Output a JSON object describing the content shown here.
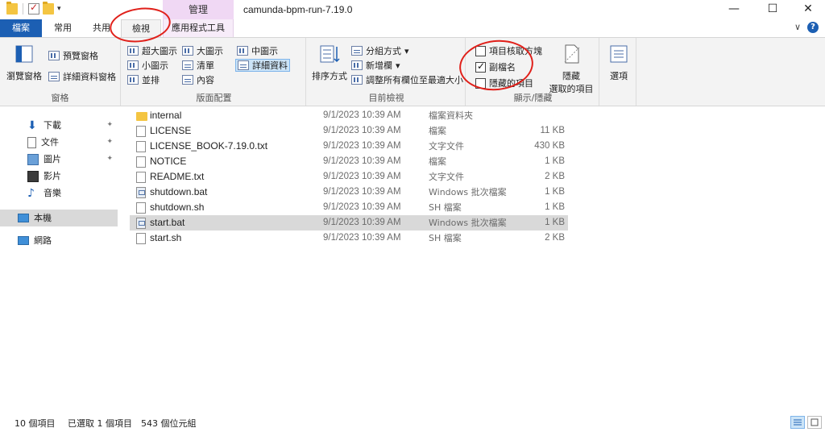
{
  "window": {
    "title": "camunda-bpm-run-7.19.0",
    "context_tab_group": "管理",
    "controls": {
      "minimize": "—",
      "maximize": "☐",
      "close": "✕"
    }
  },
  "tabs": {
    "file": "檔案",
    "home": "常用",
    "share": "共用",
    "view": "檢視",
    "app_tools": "應用程式工具",
    "right_chevron": "∨",
    "help": "?"
  },
  "ribbon": {
    "panes": {
      "label": "窗格",
      "nav_pane": "瀏覽窗格",
      "preview_pane": "預覽窗格",
      "details_pane": "詳細資料窗格"
    },
    "layout": {
      "label": "版面配置",
      "extra_large": "超大圖示",
      "large": "大圖示",
      "medium": "中圖示",
      "small": "小圖示",
      "list": "清單",
      "details": "詳細資料",
      "tiles": "並排",
      "content": "內容"
    },
    "current_view": {
      "label": "目前檢視",
      "sort_by": "排序方式",
      "group_by": "分組方式",
      "add_columns": "新增欄",
      "size_columns": "調整所有欄位至最適大小"
    },
    "show_hide": {
      "label": "顯示/隱藏",
      "item_checkboxes": "項目核取方塊",
      "item_checkboxes_checked": false,
      "file_extensions": "副檔名",
      "file_extensions_checked": true,
      "hidden_items": "隱藏的項目",
      "hidden_items_checked": false,
      "hide_selected_1": "隱藏",
      "hide_selected_2": "選取的項目"
    },
    "options": "選項"
  },
  "nav": {
    "items": [
      {
        "label": "下載",
        "icon": "download-icon",
        "pinned": true
      },
      {
        "label": "文件",
        "icon": "documents-icon",
        "pinned": true
      },
      {
        "label": "圖片",
        "icon": "pictures-icon",
        "pinned": true
      },
      {
        "label": "影片",
        "icon": "videos-icon",
        "pinned": false
      },
      {
        "label": "音樂",
        "icon": "music-icon",
        "pinned": false
      },
      {
        "label": "本機",
        "icon": "this-pc-icon",
        "pinned": false
      },
      {
        "label": "網路",
        "icon": "network-icon",
        "pinned": false
      }
    ],
    "pin_glyph": "📌"
  },
  "files": [
    {
      "name": "internal",
      "date": "9/1/2023 10:39 AM",
      "type": "檔案資料夾",
      "size": "",
      "kind": "folder"
    },
    {
      "name": "LICENSE",
      "date": "9/1/2023 10:39 AM",
      "type": "檔案",
      "size": "11 KB",
      "kind": "doc"
    },
    {
      "name": "LICENSE_BOOK-7.19.0.txt",
      "date": "9/1/2023 10:39 AM",
      "type": "文字文件",
      "size": "430 KB",
      "kind": "doc"
    },
    {
      "name": "NOTICE",
      "date": "9/1/2023 10:39 AM",
      "type": "檔案",
      "size": "1 KB",
      "kind": "doc"
    },
    {
      "name": "README.txt",
      "date": "9/1/2023 10:39 AM",
      "type": "文字文件",
      "size": "2 KB",
      "kind": "doc"
    },
    {
      "name": "shutdown.bat",
      "date": "9/1/2023 10:39 AM",
      "type": "Windows 批次檔案",
      "size": "1 KB",
      "kind": "bat"
    },
    {
      "name": "shutdown.sh",
      "date": "9/1/2023 10:39 AM",
      "type": "SH 檔案",
      "size": "1 KB",
      "kind": "doc"
    },
    {
      "name": "start.bat",
      "date": "9/1/2023 10:39 AM",
      "type": "Windows 批次檔案",
      "size": "1 KB",
      "kind": "bat",
      "selected": true
    },
    {
      "name": "start.sh",
      "date": "9/1/2023 10:39 AM",
      "type": "SH 檔案",
      "size": "2 KB",
      "kind": "doc"
    }
  ],
  "status": {
    "count": "10 個項目",
    "selected": "已選取 1 個項目",
    "size": "543 個位元組"
  },
  "colors": {
    "file_tab": "#1c5fb3",
    "context_tab": "#f0d8f4",
    "selection": "#d9d9d9",
    "annotation": "#e0201a"
  }
}
